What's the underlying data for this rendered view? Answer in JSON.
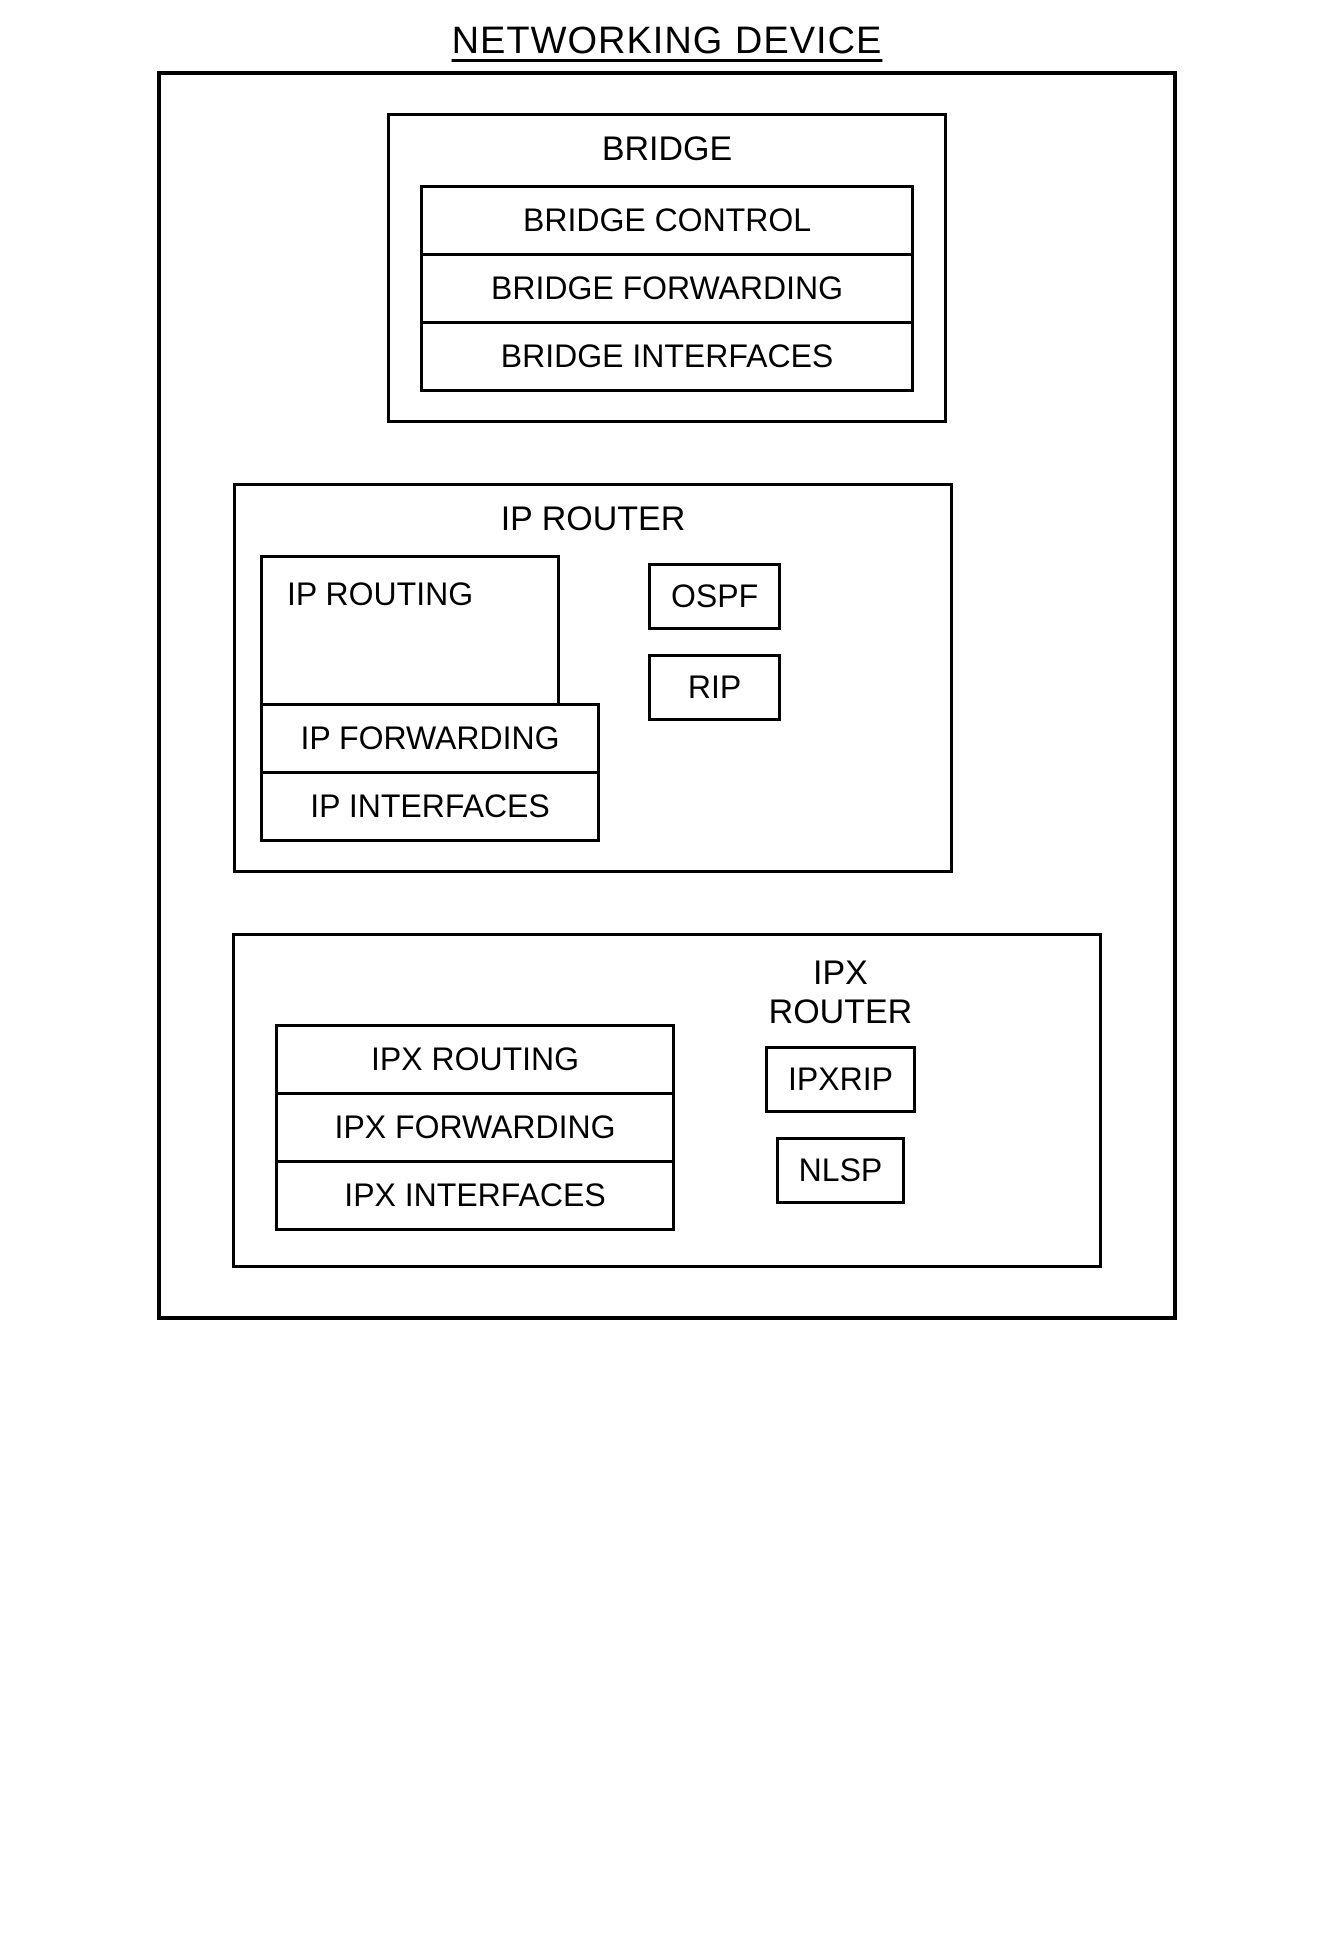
{
  "title": "NETWORKING DEVICE",
  "bridge": {
    "title": "BRIDGE",
    "rows": [
      "BRIDGE CONTROL",
      "BRIDGE FORWARDING",
      "BRIDGE INTERFACES"
    ]
  },
  "ip": {
    "title": "IP ROUTER",
    "routing": "IP ROUTING",
    "rows": [
      "IP FORWARDING",
      "IP INTERFACES"
    ],
    "protocols": [
      "OSPF",
      "RIP"
    ]
  },
  "ipx": {
    "title_line1": "IPX",
    "title_line2": "ROUTER",
    "rows": [
      "IPX ROUTING",
      "IPX FORWARDING",
      "IPX INTERFACES"
    ],
    "protocols": [
      "IPXRIP",
      "NLSP"
    ]
  }
}
